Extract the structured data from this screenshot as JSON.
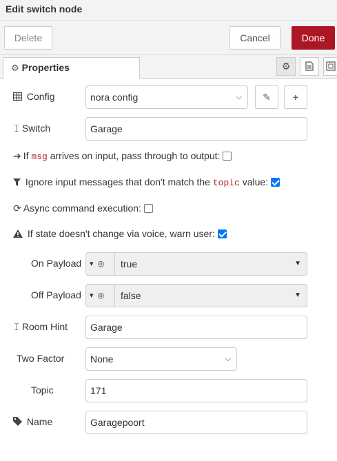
{
  "dialog": {
    "title": "Edit switch node"
  },
  "toolbar": {
    "delete_label": "Delete",
    "cancel_label": "Cancel",
    "done_label": "Done"
  },
  "tabs": {
    "properties_label": "Properties",
    "icons": [
      "gear-icon",
      "description-icon",
      "appearance-icon"
    ]
  },
  "form": {
    "config": {
      "label": "Config",
      "value": "nora config"
    },
    "switch": {
      "label": "Switch",
      "value": "Garage"
    },
    "passthru": {
      "pre": "If",
      "code": "msg",
      "post": "arrives on input, pass through to output:",
      "checked": false
    },
    "ignore": {
      "pre": "Ignore input messages that don't match the",
      "code": "topic",
      "post": "value:",
      "checked": true
    },
    "async": {
      "label": "Async command execution:",
      "checked": false
    },
    "warn": {
      "label": "If state doesn't change via voice, warn user:",
      "checked": true
    },
    "on_payload": {
      "label": "On Payload",
      "value": "true"
    },
    "off_payload": {
      "label": "Off Payload",
      "value": "false"
    },
    "room_hint": {
      "label": "Room Hint",
      "value": "Garage"
    },
    "two_factor": {
      "label": "Two Factor",
      "value": "None"
    },
    "topic": {
      "label": "Topic",
      "value": "171"
    },
    "name": {
      "label": "Name",
      "value": "Garagepoort"
    }
  },
  "colors": {
    "done": "#ad1625",
    "checkbox": "#0075ff",
    "code": "#aa2222"
  }
}
